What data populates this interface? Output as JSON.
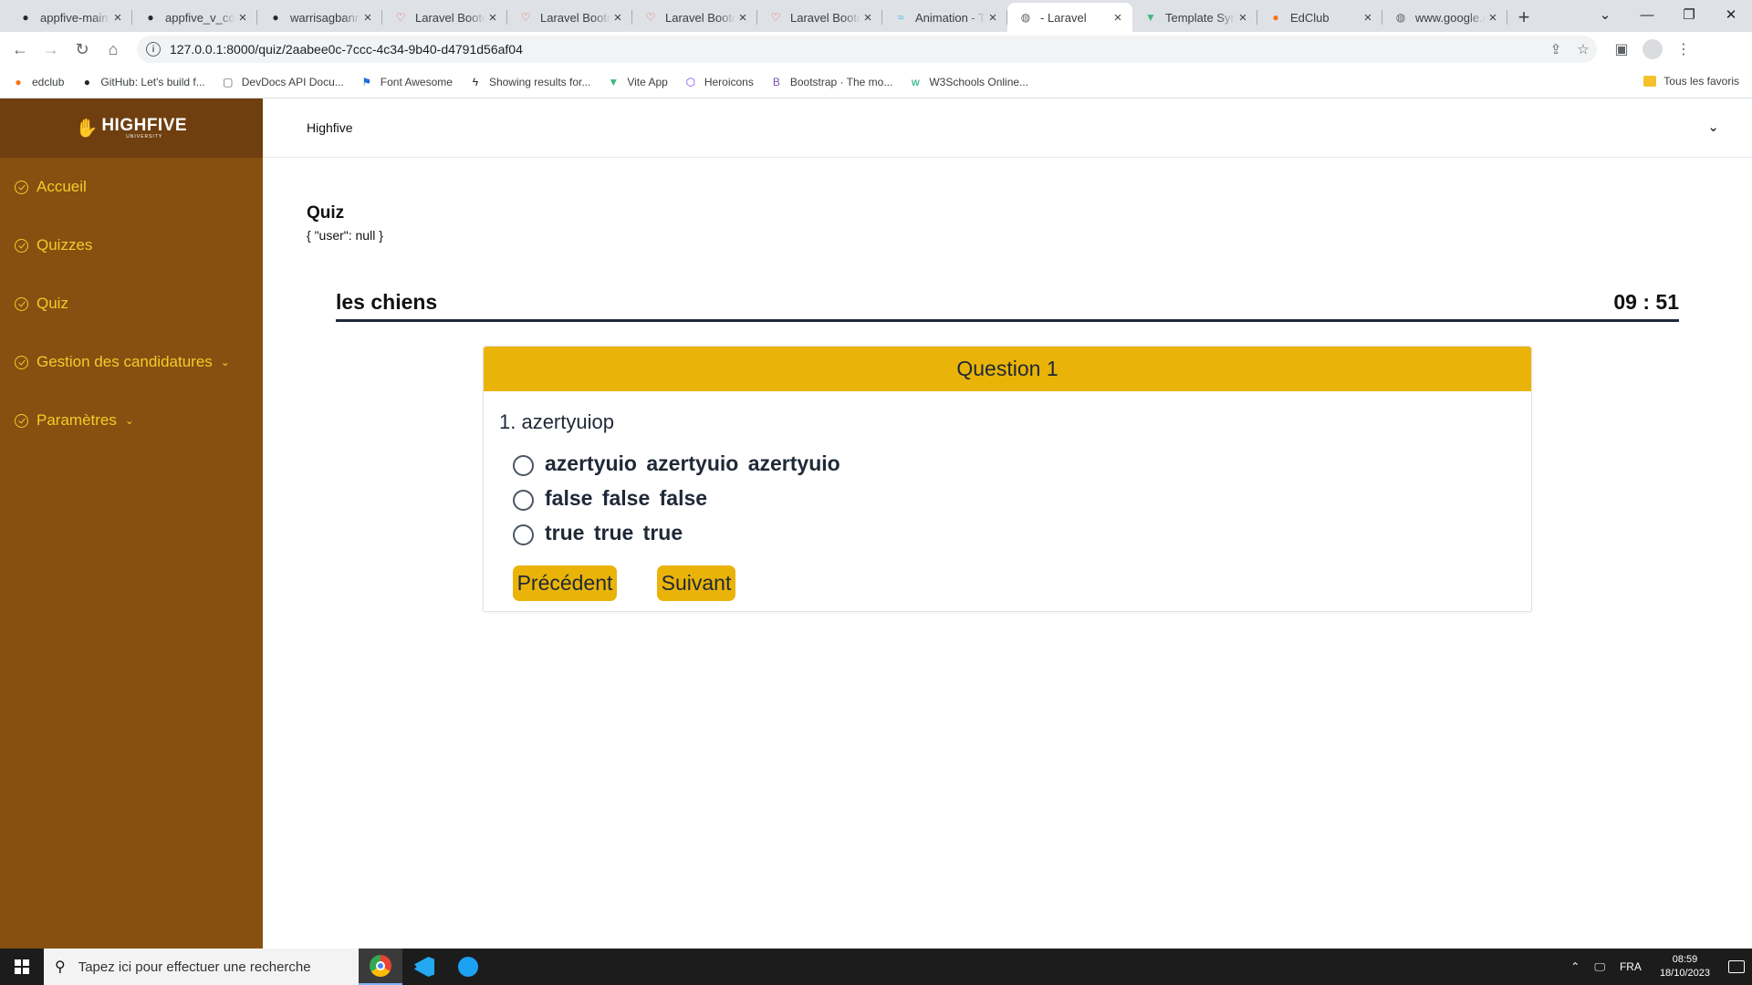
{
  "browser": {
    "tabs": [
      {
        "title": "appfive-main",
        "icon": "github-icon"
      },
      {
        "title": "appfive_v_cor",
        "icon": "github-icon"
      },
      {
        "title": "warrisagbann",
        "icon": "github-icon"
      },
      {
        "title": "Laravel Bootc",
        "icon": "laravel-icon"
      },
      {
        "title": "Laravel Bootc",
        "icon": "laravel-icon"
      },
      {
        "title": "Laravel Bootc",
        "icon": "laravel-icon"
      },
      {
        "title": "Laravel Bootc",
        "icon": "laravel-icon"
      },
      {
        "title": "Animation - T",
        "icon": "tailwind-icon"
      },
      {
        "title": " - Laravel",
        "icon": "globe-icon",
        "active": true
      },
      {
        "title": "Template Syn",
        "icon": "vue-icon"
      },
      {
        "title": "EdClub",
        "icon": "edclub-icon"
      },
      {
        "title": "www.google.c",
        "icon": "globe-icon"
      }
    ],
    "url": "127.0.0.1:8000/quiz/2aabee0c-7ccc-4c34-9b40-d4791d56af04",
    "bookmarks": [
      {
        "label": "edclub",
        "icon": "edclub-icon"
      },
      {
        "label": "GitHub: Let's build f...",
        "icon": "github-icon"
      },
      {
        "label": "DevDocs API Docu...",
        "icon": "devdocs-icon"
      },
      {
        "label": "Font Awesome",
        "icon": "flag-icon"
      },
      {
        "label": "Showing results for...",
        "icon": "vite-icon"
      },
      {
        "label": "Vite App",
        "icon": "vue-icon"
      },
      {
        "label": "Heroicons",
        "icon": "heroicons-icon"
      },
      {
        "label": "Bootstrap · The mo...",
        "icon": "bootstrap-icon"
      },
      {
        "label": "W3Schools Online...",
        "icon": "w3schools-icon"
      }
    ],
    "all_bookmarks": "Tous les favoris"
  },
  "app": {
    "brand": "HIGHFIVE",
    "brand_sub": "UNIVERSITY",
    "header_title": "Highfive",
    "sidebar": [
      {
        "label": "Accueil",
        "expandable": false
      },
      {
        "label": "Quizzes",
        "expandable": false
      },
      {
        "label": "Quiz",
        "expandable": false
      },
      {
        "label": "Gestion des candidatures",
        "expandable": true
      },
      {
        "label": "Paramètres",
        "expandable": true
      }
    ],
    "colors": {
      "sidebar": "#865011",
      "brand_bar": "#6f3f10",
      "accent": "#eab308",
      "menu_text": "#f4cc27"
    }
  },
  "page": {
    "title": "Quiz",
    "debug": "{ \"user\": null }",
    "quiz_name": "les chiens",
    "timer": "09 : 51",
    "question_header": "Question 1",
    "question_text": "1. azertyuiop",
    "options": [
      {
        "label": "azertyuio azertyuio azertyuio",
        "selected": false
      },
      {
        "label": "false false false",
        "selected": false
      },
      {
        "label": "true true true",
        "selected": false
      }
    ],
    "prev_label": "Précédent",
    "next_label": "Suivant"
  },
  "taskbar": {
    "search_placeholder": "Tapez ici pour effectuer une recherche",
    "language": "FRA",
    "time": "08:59",
    "date": "18/10/2023"
  }
}
